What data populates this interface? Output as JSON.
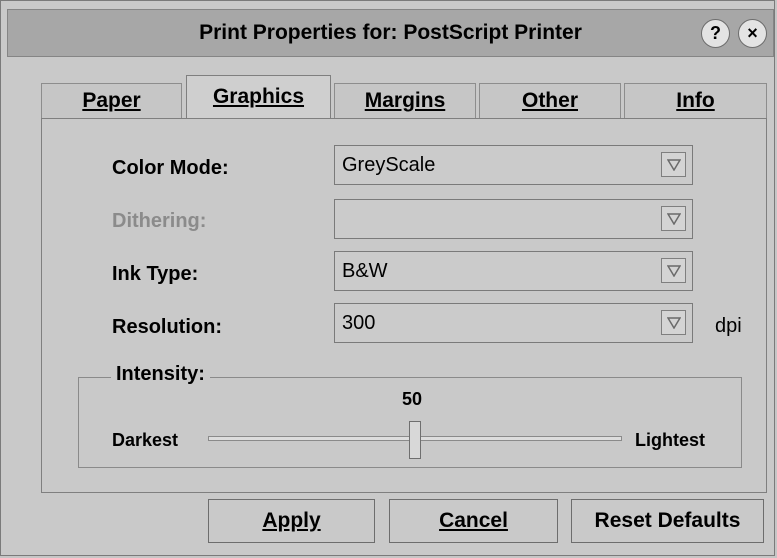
{
  "window": {
    "title": "Print Properties for: PostScript Printer",
    "help_icon": "question-mark-icon",
    "close_icon": "close-icon"
  },
  "tabs": [
    {
      "label": "Paper",
      "active": false
    },
    {
      "label": "Graphics",
      "active": true
    },
    {
      "label": "Margins",
      "active": false
    },
    {
      "label": "Other",
      "active": false
    },
    {
      "label": "Info",
      "active": false
    }
  ],
  "form": {
    "color_mode_label": "Color Mode:",
    "color_mode_value": "GreyScale",
    "dithering_label": "Dithering:",
    "dithering_value": "",
    "ink_type_label": "Ink Type:",
    "ink_type_value": "B&W",
    "resolution_label": "Resolution:",
    "resolution_value": "300",
    "resolution_unit": "dpi",
    "intensity_label": "Intensity:",
    "intensity_value": "50",
    "intensity_fraction": 0.5,
    "darkest_label": "Darkest",
    "lightest_label": "Lightest"
  },
  "buttons": {
    "apply": "Apply",
    "cancel": "Cancel",
    "reset_defaults": "Reset Defaults"
  }
}
